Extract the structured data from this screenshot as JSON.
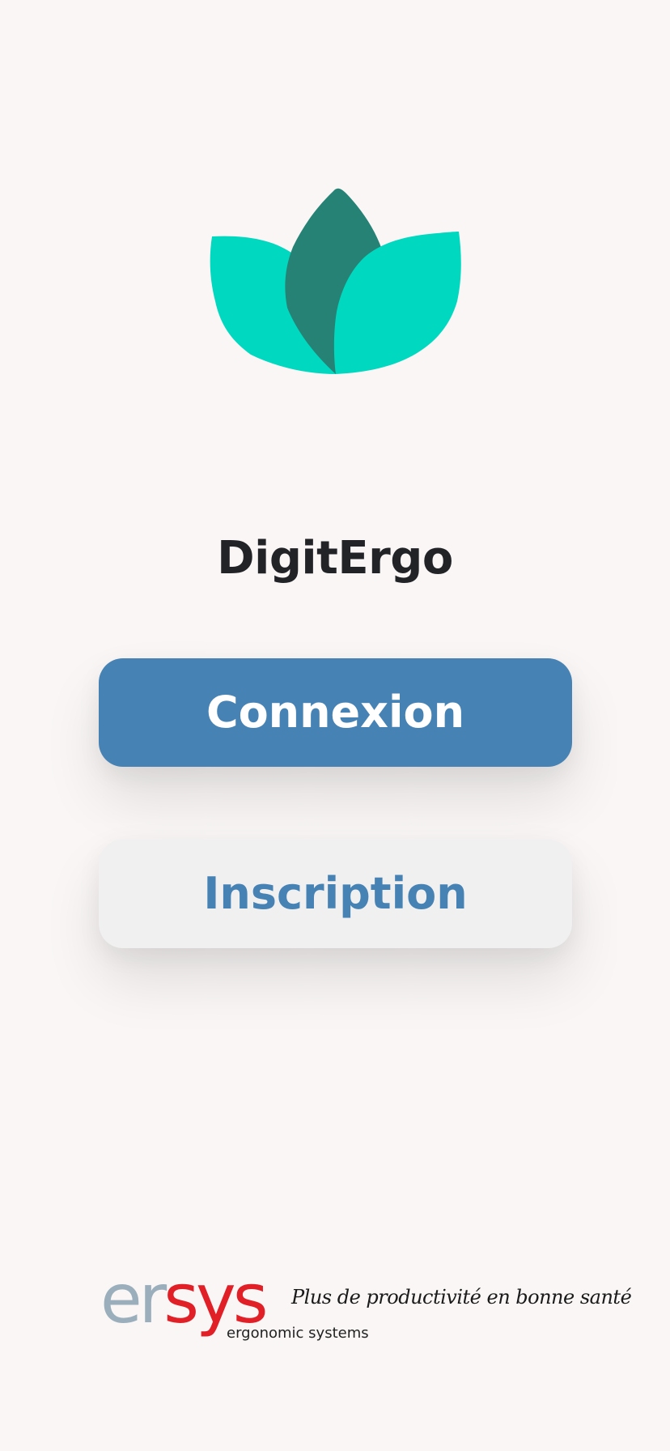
{
  "app": {
    "title": "DigitErgo"
  },
  "logo": {
    "icon": "lotus-leaves-icon",
    "colors": {
      "outer_leaves": "#00d9bf",
      "center_leaf": "#258275"
    }
  },
  "actions": {
    "login_label": "Connexion",
    "signup_label": "Inscription"
  },
  "colors": {
    "background": "#f9f6f5",
    "primary": "#4682b4",
    "secondary_button": "#f0f0f0",
    "title_text": "#222327"
  },
  "footer": {
    "brand_prefix": "er",
    "brand_suffix": "sys",
    "brand_subtitle": "ergonomic systems",
    "slogan": "Plus de productivité en bonne santé",
    "colors": {
      "brand_prefix": "#9aaebb",
      "brand_suffix": "#e11f26"
    }
  }
}
